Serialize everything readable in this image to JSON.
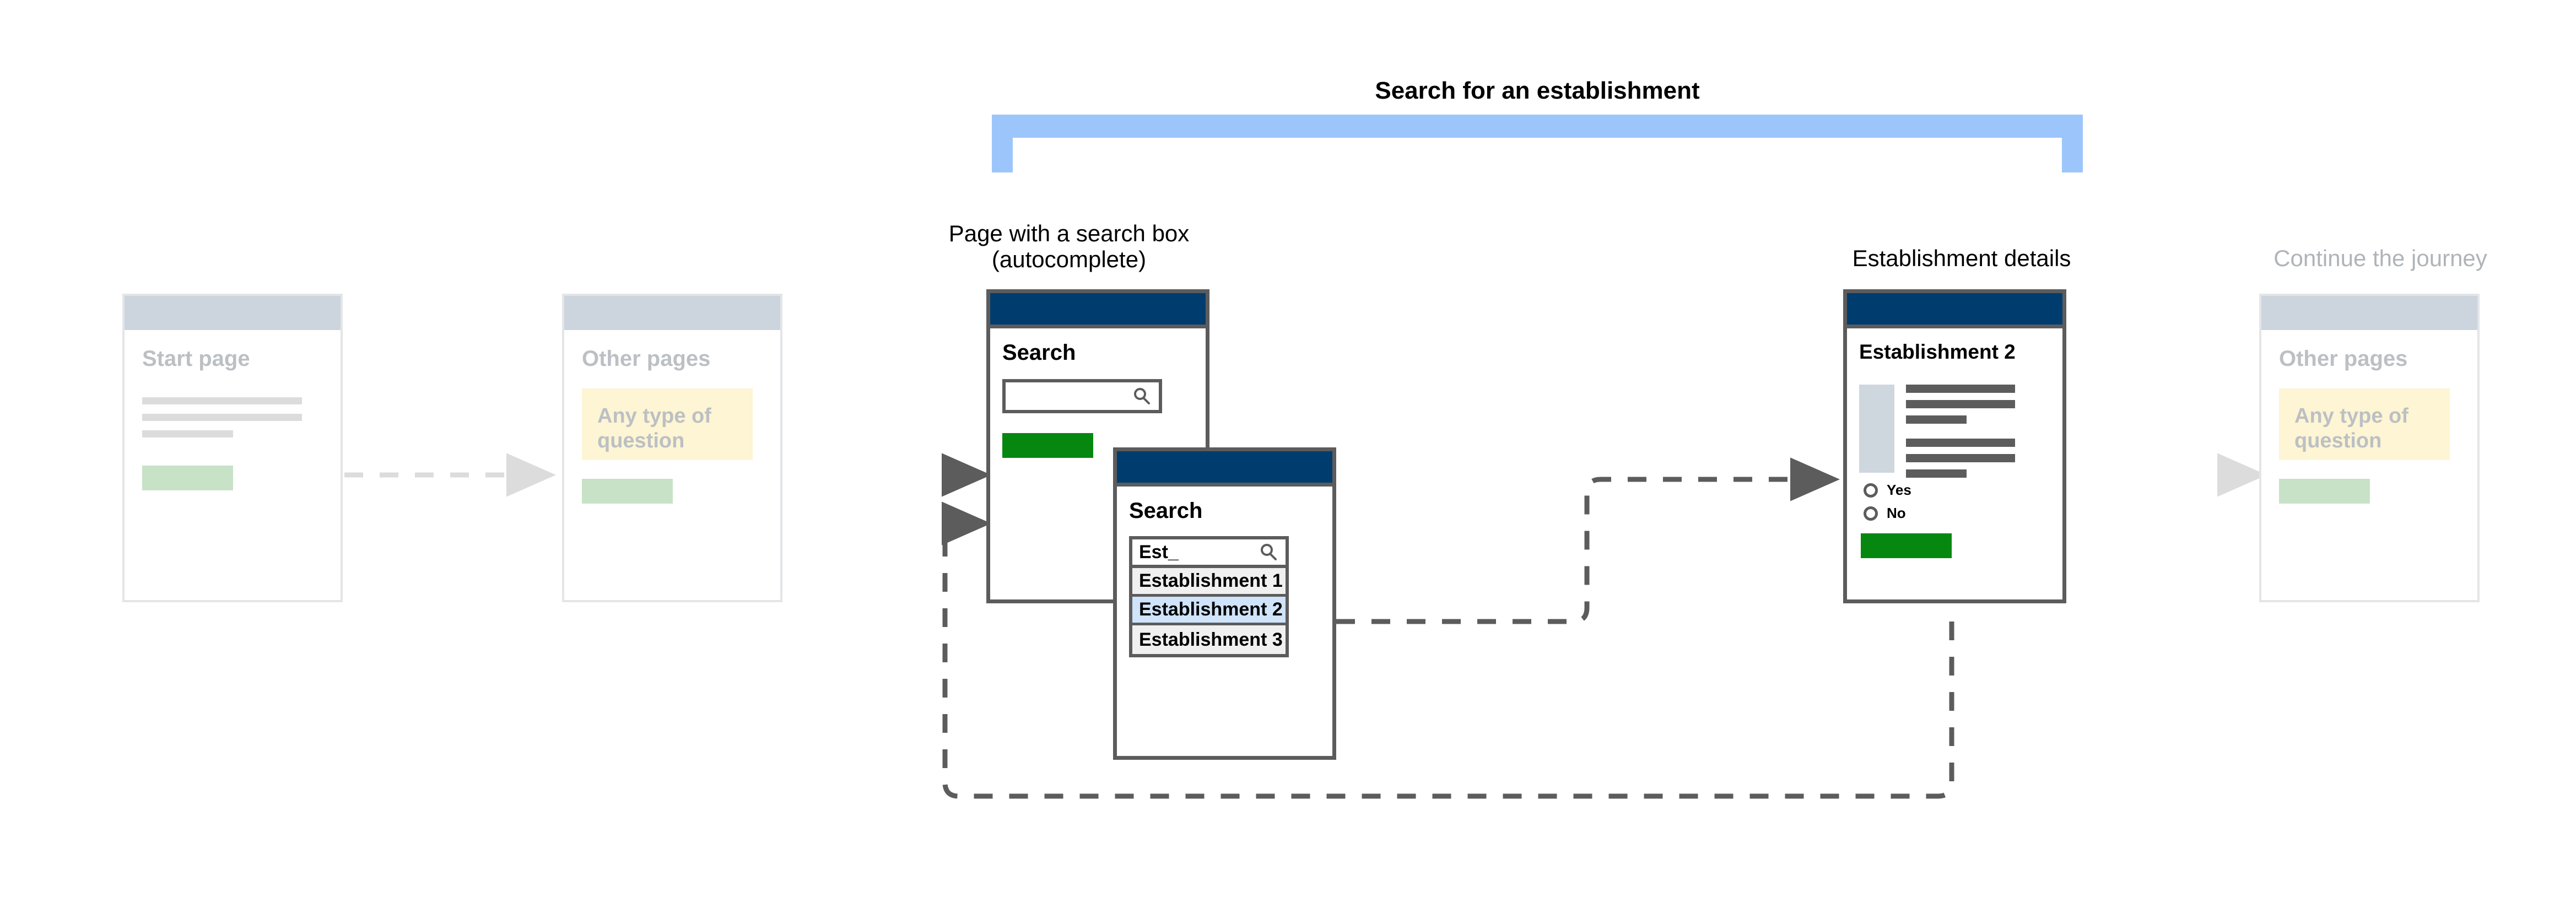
{
  "section": {
    "title": "Search for an establishment",
    "bracket_color": "#9cc6fb"
  },
  "captions": {
    "search_page": "Page with a search box\n(autocomplete)",
    "establishment_details": "Establishment details",
    "continue_journey": "Continue the journey"
  },
  "colors": {
    "header_navy": "#003d6e",
    "header_ghost": "#ccd5de",
    "button_green": "#068810",
    "button_green_ghost": "#c8e2c8",
    "question_yellow": "#fdf5d3",
    "highlight_blue": "#cfe3fa",
    "border_gray": "#5c5c5c",
    "border_ghost": "#e3e5e7",
    "image_placeholder": "#ced6de"
  },
  "cards": {
    "start_page": {
      "title": "Start page",
      "state": "ghost",
      "lines": 3
    },
    "other_pages_left": {
      "title": "Other pages",
      "state": "ghost",
      "question_label": "Any type of question"
    },
    "search_page": {
      "title": "Search",
      "state": "active",
      "input_value": "",
      "input_placeholder": "",
      "search_icon": "search-icon"
    },
    "autocomplete": {
      "title": "Search",
      "state": "active",
      "input_value": "Est_",
      "search_icon": "search-icon",
      "suggestions": [
        {
          "label": "Establishment 1",
          "selected": false
        },
        {
          "label": "Establishment 2",
          "selected": true
        },
        {
          "label": "Establishment 3",
          "selected": false
        }
      ]
    },
    "establishment_details": {
      "title": "Establishment 2",
      "state": "active",
      "detail_lines": 6,
      "radios": [
        {
          "label": "Yes",
          "checked": false
        },
        {
          "label": "No",
          "checked": false
        }
      ]
    },
    "other_pages_right": {
      "title": "Other pages",
      "state": "ghost",
      "question_label": "Any type of question"
    }
  }
}
